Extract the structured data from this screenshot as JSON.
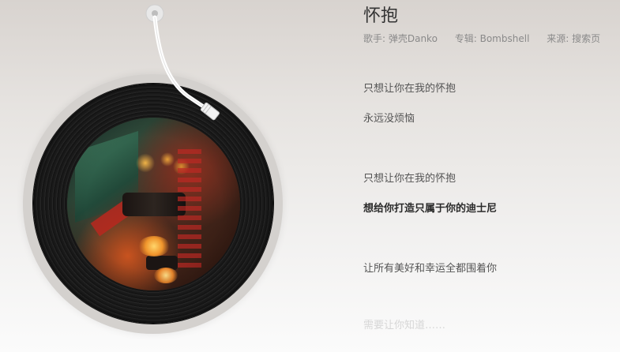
{
  "song": {
    "title": "怀抱",
    "singer": "歌手: 弹壳Danko",
    "album": "专辑: Bombshell",
    "source": "来源: 搜索页"
  },
  "lyrics": [
    {
      "text": "只想让你在我的怀抱",
      "current": false
    },
    {
      "text": "永远没烦恼",
      "current": false
    },
    {
      "text": "只想让你在我的怀抱",
      "current": false
    },
    {
      "text": "想给你打造只属于你的迪士尼",
      "current": true
    },
    {
      "text": "让所有美好和幸运全都围着你",
      "current": false
    },
    {
      "text": "需要让你知道……",
      "current": false
    }
  ],
  "player": {
    "cover_icon": "album-cover-image",
    "tonearm_icon": "tonearm-icon",
    "vinyl_icon": "vinyl-record-icon"
  },
  "colors": {
    "background_top": "#d8d3cf",
    "background_bottom": "#fbfbfb",
    "title": "#333333",
    "meta": "#8a8a8a",
    "lyric": "#555555",
    "lyric_current": "#2a2a2a"
  }
}
